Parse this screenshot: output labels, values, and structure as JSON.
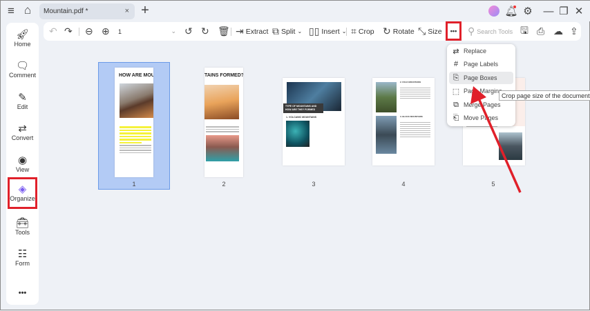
{
  "titlebar": {
    "tab_label": "Mountain.pdf *",
    "close": "×",
    "new_tab": "+",
    "menu_icon": "≡",
    "home_icon": "⌂"
  },
  "sidebar": {
    "items": [
      {
        "label": "Home",
        "icon": "rocket-icon"
      },
      {
        "label": "Comment",
        "icon": "comment-icon"
      },
      {
        "label": "Edit",
        "icon": "edit-icon"
      },
      {
        "label": "Convert",
        "icon": "convert-icon"
      },
      {
        "label": "View",
        "icon": "view-icon"
      },
      {
        "label": "Organize",
        "icon": "organize-icon"
      },
      {
        "label": "Tools",
        "icon": "tools-icon"
      },
      {
        "label": "Form",
        "icon": "form-icon"
      }
    ],
    "more": "•••"
  },
  "toolbar": {
    "page_value": "1",
    "extract": "Extract",
    "split": "Split",
    "insert": "Insert",
    "crop": "Crop",
    "rotate": "Rotate",
    "size": "Size",
    "more": "•••",
    "search_placeholder": "Search Tools"
  },
  "pages": [
    {
      "number": "1",
      "title": "HOW ARE MOUNT",
      "selected": true
    },
    {
      "number": "2",
      "title": "TAINS FORMED?"
    },
    {
      "number": "3",
      "title": "TYPE OF MOUNTAINS AND HOW ARE THEY FORMED",
      "subtitle": "1. VOLCANIC MOUNTAINS"
    },
    {
      "number": "4",
      "subtitle": "2. FOLD MOUNTAINS",
      "subtitle2": "3. BLOCK MOUNTAINS"
    },
    {
      "number": "5"
    }
  ],
  "more_menu": {
    "items": [
      "Replace",
      "Page Labels",
      "Page Boxes",
      "Page Margins",
      "Merge Pages",
      "Move Pages"
    ],
    "highlighted": "Page Boxes"
  },
  "tooltip": "Crop page size of the document",
  "colors": {
    "accent_red": "#e0202a",
    "selection": "#b3cbf5",
    "highlight": "#f5f23a"
  }
}
